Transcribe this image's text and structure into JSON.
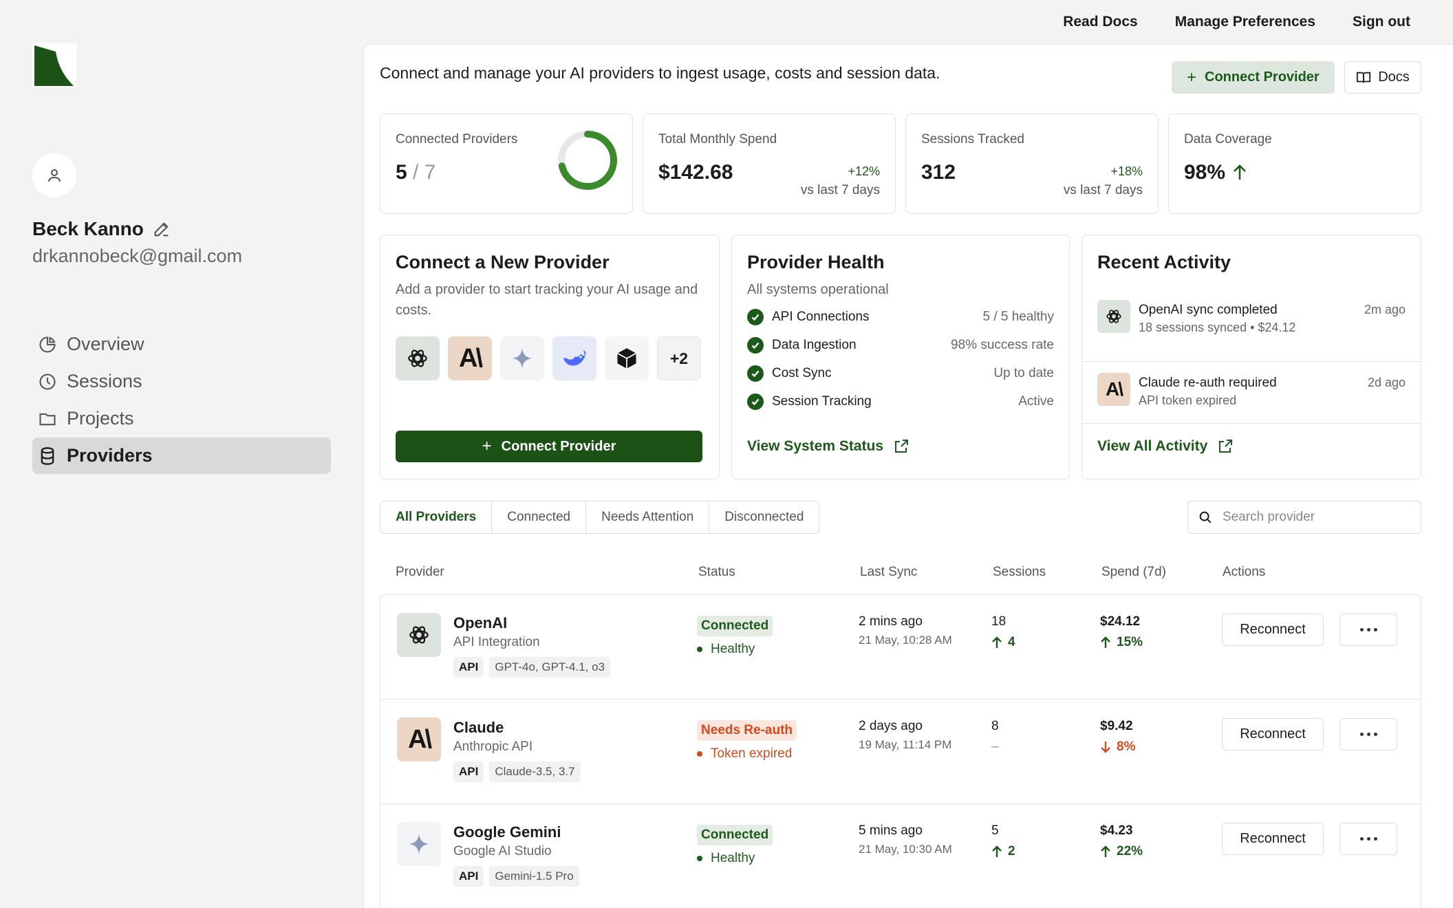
{
  "topnav": {
    "read_docs": "Read Docs",
    "manage_prefs": "Manage Preferences",
    "sign_out": "Sign out"
  },
  "user": {
    "name": "Beck Kanno",
    "email": "drkannobeck@gmail.com"
  },
  "sidebar": {
    "items": [
      {
        "label": "Overview",
        "icon": "pie-chart-icon",
        "active": false
      },
      {
        "label": "Sessions",
        "icon": "clock-icon",
        "active": false
      },
      {
        "label": "Projects",
        "icon": "folder-icon",
        "active": false
      },
      {
        "label": "Providers",
        "icon": "database-icon",
        "active": true
      }
    ]
  },
  "header": {
    "intro": "Connect and manage your AI providers to ingest usage, costs and session data.",
    "connect_label": "Connect Provider",
    "docs_label": "Docs"
  },
  "stats": {
    "connected": {
      "label": "Connected Providers",
      "value": "5",
      "total": "/ 7",
      "ratio": 0.714
    },
    "spend": {
      "label": "Total Monthly Spend",
      "value": "$142.68",
      "change": "+12%",
      "sub": "vs last 7 days"
    },
    "sessions": {
      "label": "Sessions Tracked",
      "value": "312",
      "change": "+18%",
      "sub": "vs last 7 days"
    },
    "coverage": {
      "label": "Data Coverage",
      "value": "98%"
    }
  },
  "connect_card": {
    "title": "Connect a New Provider",
    "subtitle": "Add a provider to start tracking your AI usage and costs.",
    "more": "+2",
    "button": "Connect Provider"
  },
  "health": {
    "title": "Provider Health",
    "subtitle": "All systems operational",
    "rows": [
      {
        "label": "API Connections",
        "value": "5 / 5 healthy"
      },
      {
        "label": "Data Ingestion",
        "value": "98% success rate"
      },
      {
        "label": "Cost Sync",
        "value": "Up to date"
      },
      {
        "label": "Session Tracking",
        "value": "Active"
      }
    ],
    "link": "View System Status"
  },
  "activity": {
    "title": "Recent Activity",
    "items": [
      {
        "title": "OpenAI sync completed",
        "sub": "18 sessions synced • $24.12",
        "time": "2m ago"
      },
      {
        "title": "Claude re-auth required",
        "sub": "API token expired",
        "time": "2d ago"
      }
    ],
    "link": "View All Activity"
  },
  "filters": {
    "tabs": [
      "All Providers",
      "Connected",
      "Needs Attention",
      "Disconnected"
    ],
    "search_placeholder": "Search provider"
  },
  "table": {
    "headers": [
      "Provider",
      "Status",
      "Last Sync",
      "Sessions",
      "Spend (7d)",
      "Actions"
    ],
    "rows": [
      {
        "name": "OpenAI",
        "sub": "API Integration",
        "tag": "API",
        "models": "GPT-4o, GPT-4.1, o3",
        "badge": "Connected",
        "status": "Healthy",
        "sync": "2 mins ago",
        "sync_date": "21 May, 10:28 AM",
        "sessions": "18",
        "sessions_delta": "4",
        "spend": "$24.12",
        "spend_delta": "15%",
        "action": "Reconnect"
      },
      {
        "name": "Claude",
        "sub": "Anthropic API",
        "tag": "API",
        "models": "Claude-3.5, 3.7",
        "badge": "Needs Re-auth",
        "status": "Token expired",
        "sync": "2 days ago",
        "sync_date": "19 May, 11:14 PM",
        "sessions": "8",
        "sessions_delta": "–",
        "spend": "$9.42",
        "spend_delta": "8%",
        "action": "Reconnect"
      },
      {
        "name": "Google Gemini",
        "sub": "Google AI Studio",
        "tag": "API",
        "models": "Gemini-1.5 Pro",
        "badge": "Connected",
        "status": "Healthy",
        "sync": "5 mins ago",
        "sync_date": "21 May, 10:30 AM",
        "sessions": "5",
        "sessions_delta": "2",
        "spend": "$4.23",
        "spend_delta": "22%",
        "action": "Reconnect"
      }
    ]
  }
}
